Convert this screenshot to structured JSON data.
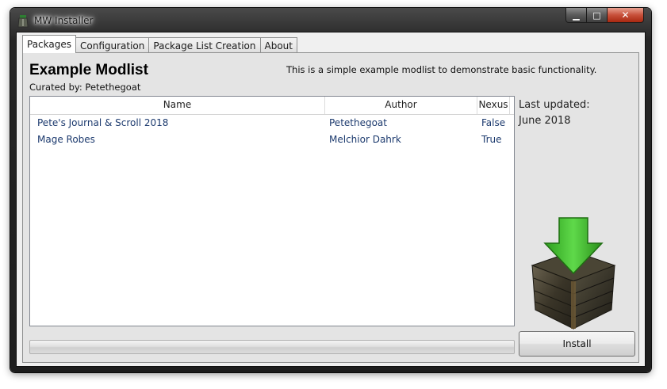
{
  "window": {
    "title": "MW Installer",
    "minimize_glyph": "▁",
    "maximize_glyph": "□",
    "close_glyph": "✕"
  },
  "tabs": [
    {
      "label": "Packages",
      "active": true
    },
    {
      "label": "Configuration",
      "active": false
    },
    {
      "label": "Package List Creation",
      "active": false
    },
    {
      "label": "About",
      "active": false
    }
  ],
  "modlist": {
    "title": "Example Modlist",
    "curated_by": "Curated by: Petethegoat",
    "description": "This is a simple example modlist to demonstrate basic functionality."
  },
  "grid": {
    "columns": [
      "Name",
      "Author",
      "Nexus"
    ],
    "rows": [
      {
        "name": "Pete's Journal & Scroll 2018",
        "author": "Petethegoat",
        "nexus": "False"
      },
      {
        "name": "Mage Robes",
        "author": "Melchior Dahrk",
        "nexus": "True"
      }
    ]
  },
  "sidebar": {
    "last_updated_label": "Last updated:",
    "last_updated_value": "June 2018"
  },
  "progress": {
    "value": 0
  },
  "install": {
    "label": "Install"
  },
  "icons": {
    "app": "app-icon",
    "crate": "crate-download-icon"
  },
  "colors": {
    "link_text": "#1c3a6e",
    "arrow_green": "#3fbf2a",
    "panel_bg": "#e4e4e4"
  }
}
